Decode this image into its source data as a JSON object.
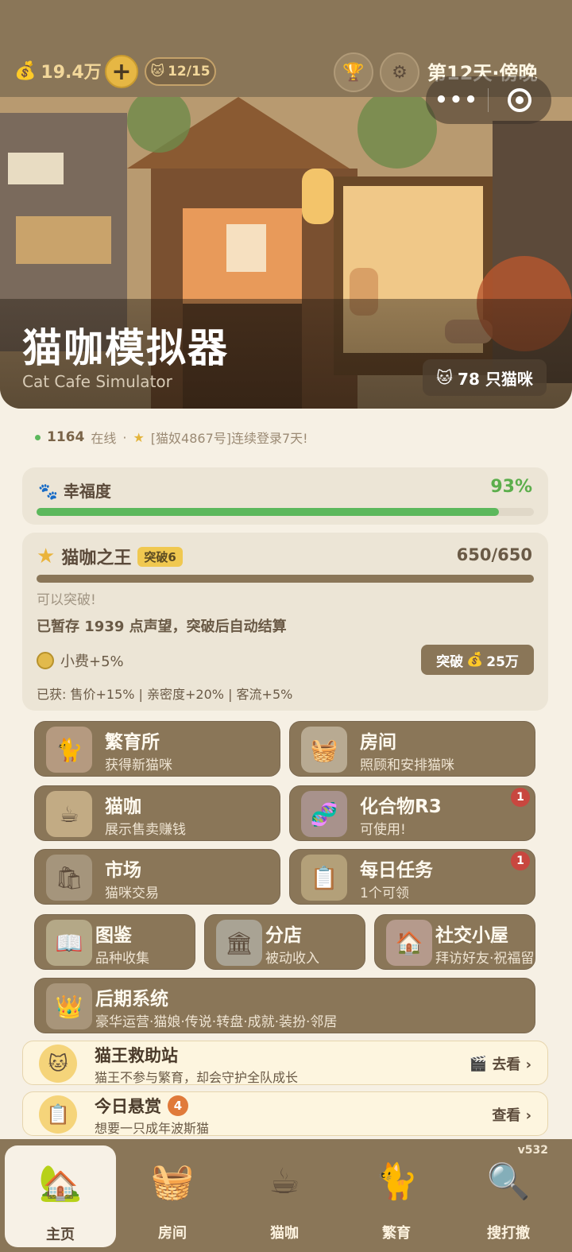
{
  "topbar": {
    "money": "19.4万",
    "money_icon": "money-bag-icon",
    "plus_label": "+",
    "cats": "12/15",
    "day": "第12天·傍晚"
  },
  "hero": {
    "title": "猫咖模拟器",
    "subtitle": "Cat Cafe Simulator",
    "cat_count": "78 只猫咪"
  },
  "status": {
    "online_count": "1164",
    "online_label": "在线",
    "separator": "·",
    "news": "[猫奴4867号]连续登录7天!"
  },
  "happiness": {
    "label": "幸福度",
    "percent_text": "93%",
    "value": 0.93,
    "color": "#5cb85c"
  },
  "king": {
    "title": "猫咖之王",
    "tag": "突破6",
    "score": "650/650",
    "progress": 1.0,
    "can_break": "可以突破!",
    "stored": "已暂存 1939 点声望，突破后自动结算",
    "tip": "小费+5%",
    "break_label": "突破",
    "break_cost": "25万",
    "gained": "已获: 售价+15% | 亲密度+20% | 客流+5%"
  },
  "menu": {
    "breed": {
      "title": "繁育所",
      "sub": "获得新猫咪"
    },
    "room": {
      "title": "房间",
      "sub": "照顾和安排猫咪"
    },
    "cafe": {
      "title": "猫咖",
      "sub": "展示售卖赚钱"
    },
    "compound": {
      "title": "化合物R3",
      "sub": "可使用!",
      "badge": "1"
    },
    "market": {
      "title": "市场",
      "sub": "猫咪交易"
    },
    "daily": {
      "title": "每日任务",
      "sub": "1个可领",
      "badge": "1"
    },
    "guide": {
      "title": "图鉴",
      "sub": "品种收集"
    },
    "branch": {
      "title": "分店",
      "sub": "被动收入"
    },
    "social": {
      "title": "社交小屋",
      "sub": "拜访好友·祝福留言"
    },
    "late": {
      "title": "后期系统",
      "sub": "豪华运营·猫娘·传说·转盘·成就·装扮·邻居"
    }
  },
  "banners": {
    "rescue": {
      "title": "猫王救助站",
      "sub": "猫王不参与繁育，却会守护全队成长",
      "action": "去看 ›"
    },
    "bounty": {
      "title": "今日悬赏",
      "count": "4",
      "sub": "想要一只成年波斯猫",
      "action": "查看 ›"
    }
  },
  "tabs": {
    "version": "v532",
    "home": "主页",
    "room": "房间",
    "cafe": "猫咖",
    "breed": "繁育",
    "search": "搜打撤"
  }
}
